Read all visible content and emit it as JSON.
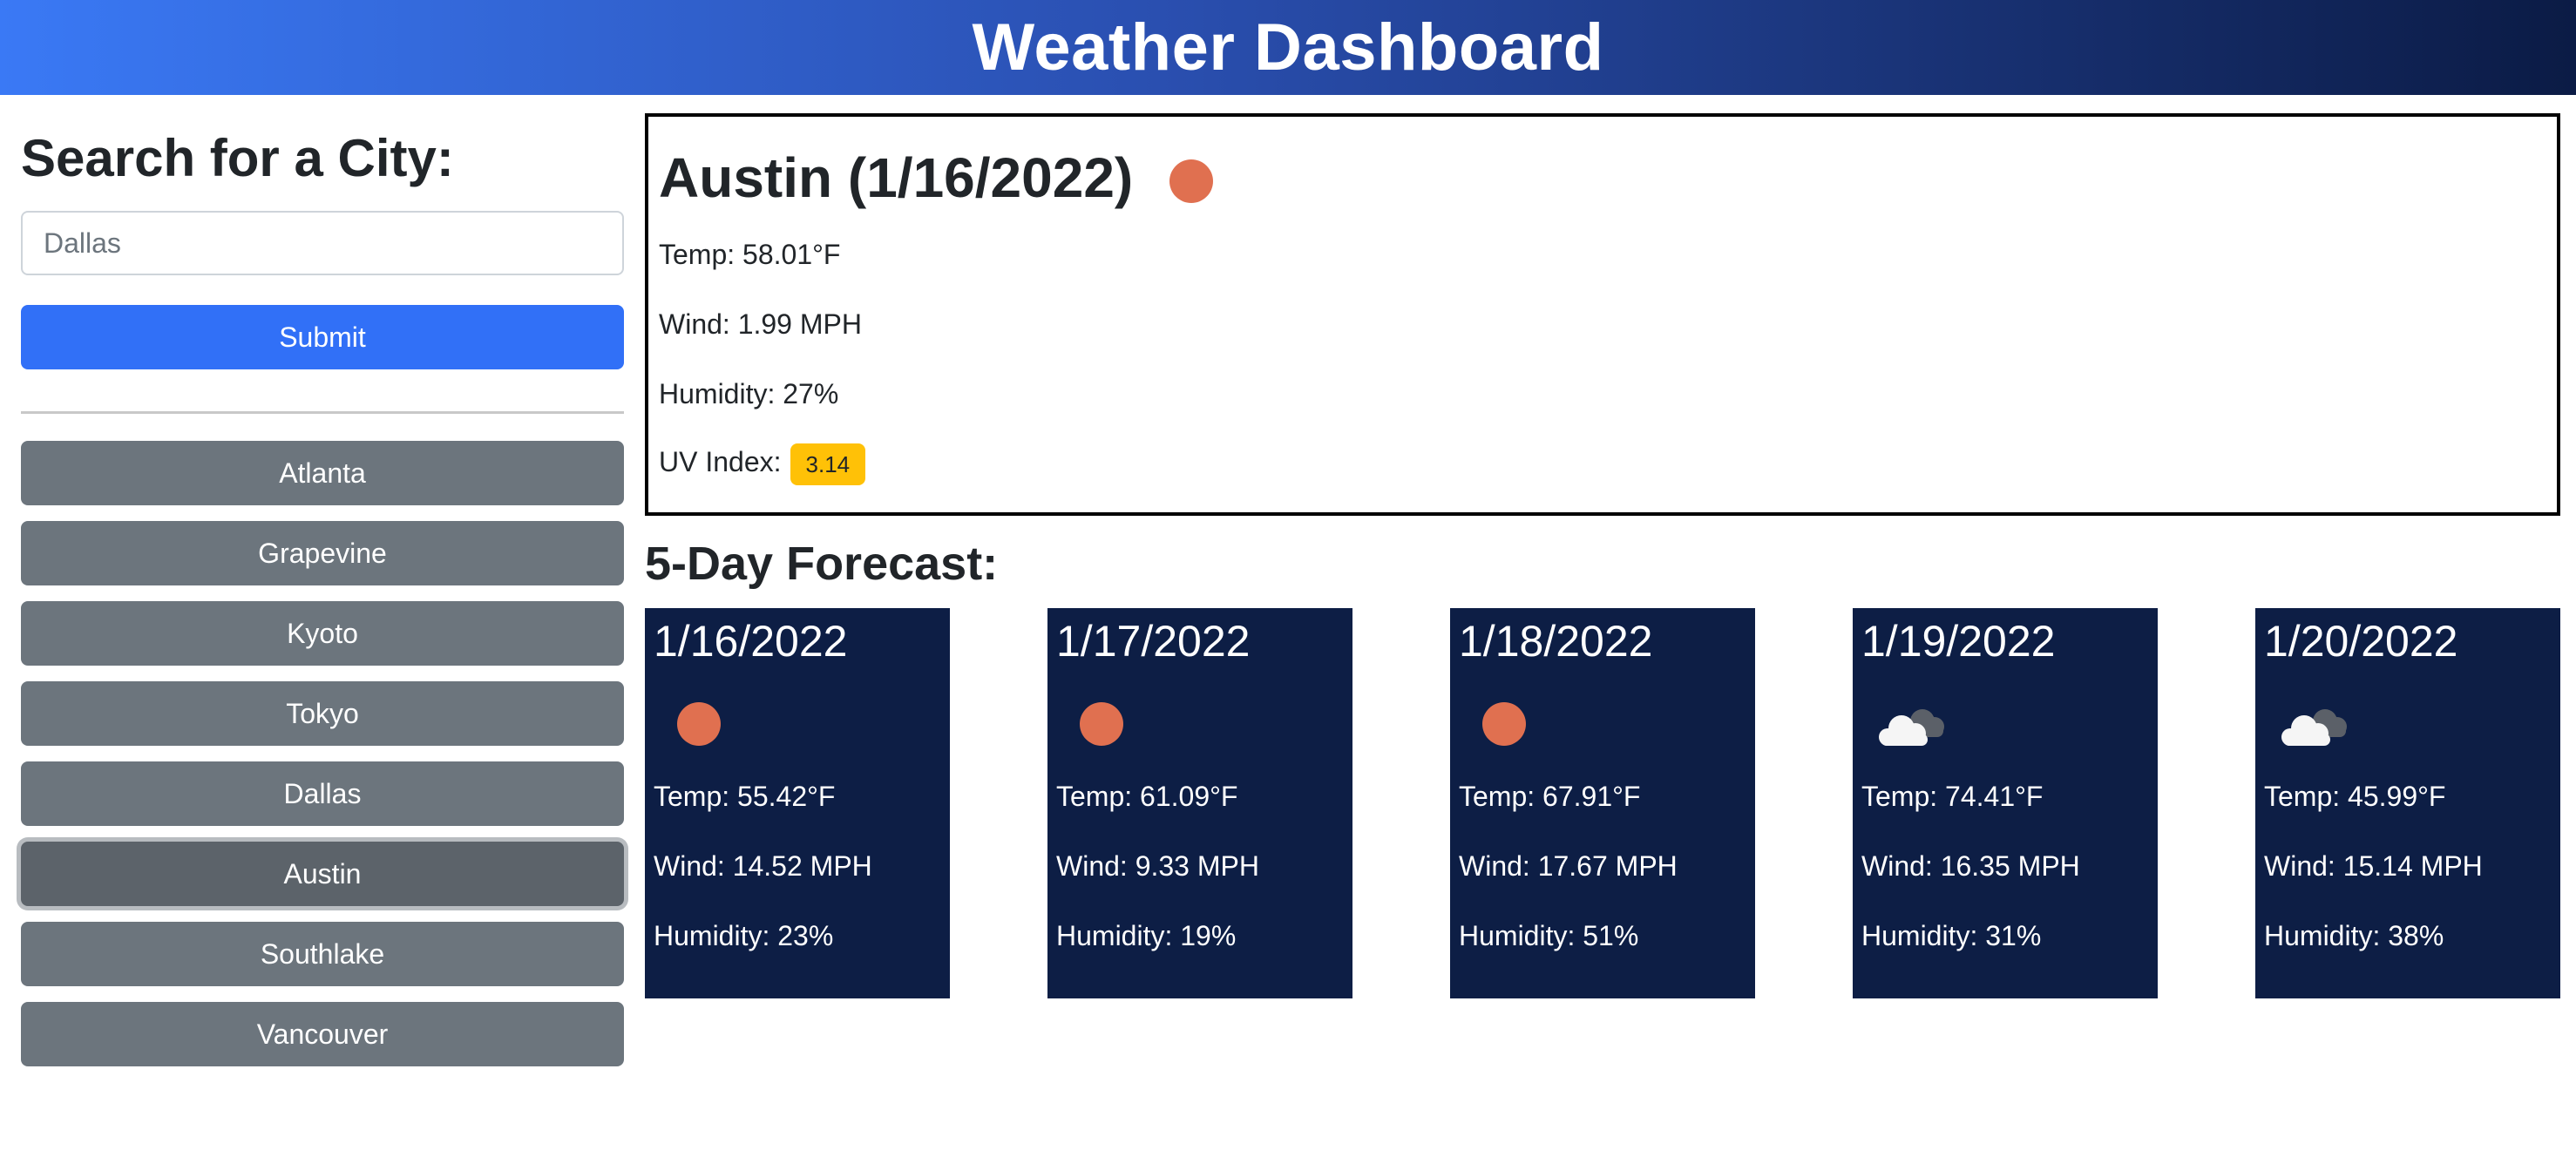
{
  "header": {
    "title": "Weather Dashboard"
  },
  "search": {
    "heading": "Search for a City:",
    "placeholder": "Dallas",
    "value": "",
    "submit_label": "Submit"
  },
  "history": {
    "cities": [
      "Atlanta",
      "Grapevine",
      "Kyoto",
      "Tokyo",
      "Dallas",
      "Austin",
      "Southlake",
      "Vancouver"
    ],
    "active_city": "Austin"
  },
  "current": {
    "title": "Austin (1/16/2022)",
    "icon": "sun-icon",
    "temp": "Temp: 58.01°F",
    "wind": "Wind: 1.99 MPH",
    "humidity": "Humidity: 27%",
    "uv_label": "UV Index:",
    "uv_value": "3.14",
    "uv_color": "#ffc107"
  },
  "forecast": {
    "heading": "5-Day Forecast:",
    "days": [
      {
        "date": "1/16/2022",
        "icon": "sun-icon",
        "temp": "Temp: 55.42°F",
        "wind": "Wind: 14.52 MPH",
        "humidity": "Humidity: 23%"
      },
      {
        "date": "1/17/2022",
        "icon": "sun-icon",
        "temp": "Temp: 61.09°F",
        "wind": "Wind: 9.33 MPH",
        "humidity": "Humidity: 19%"
      },
      {
        "date": "1/18/2022",
        "icon": "sun-icon",
        "temp": "Temp: 67.91°F",
        "wind": "Wind: 17.67 MPH",
        "humidity": "Humidity: 51%"
      },
      {
        "date": "1/19/2022",
        "icon": "cloud-icon",
        "temp": "Temp: 74.41°F",
        "wind": "Wind: 16.35 MPH",
        "humidity": "Humidity: 31%"
      },
      {
        "date": "1/20/2022",
        "icon": "cloud-icon",
        "temp": "Temp: 45.99°F",
        "wind": "Wind: 15.14 MPH",
        "humidity": "Humidity: 38%"
      }
    ]
  },
  "colors": {
    "header_start": "#3a79f5",
    "header_end": "#0b1b45",
    "submit": "#3170f7",
    "city_button": "#6c757d",
    "card": "#0d1e45",
    "sun": "#e07050"
  }
}
